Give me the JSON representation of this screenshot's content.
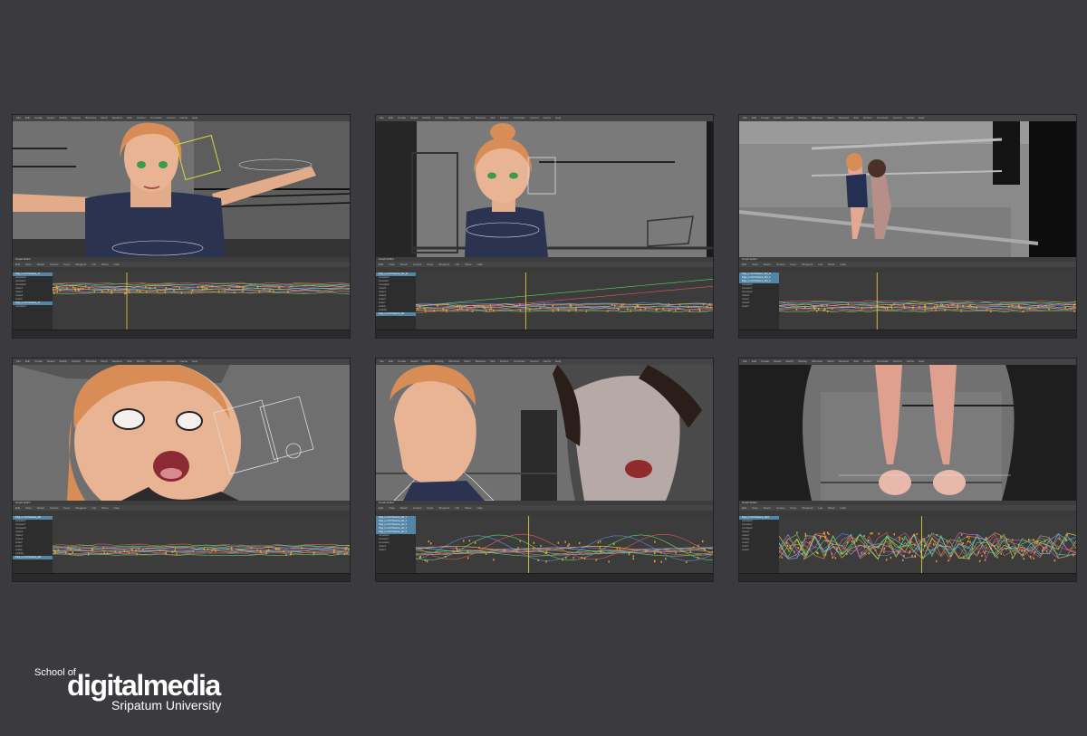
{
  "menu": [
    "File",
    "Edit",
    "Create",
    "Select",
    "Modify",
    "Display",
    "Windows",
    "Mesh",
    "Skeleton",
    "Skin",
    "Deform",
    "Constrain",
    "Control",
    "Cache",
    "Help"
  ],
  "graph_editor": {
    "title": "Graph Editor",
    "menus": [
      "Edit",
      "View",
      "Select",
      "Curves",
      "Keys",
      "Tangents",
      "List",
      "Show",
      "Help"
    ]
  },
  "colors": {
    "background": "#3b3a3e",
    "selected_row": "#5285a6",
    "keys": "#e8a02a",
    "time_marker": "#f4d62f"
  },
  "panels": [
    {
      "id": "p1",
      "channels": [
        "Ptgs_Lc:ctrl.Sharma_I3",
        "translateX",
        "translateY",
        "translateZ",
        "rotateX",
        "rotateY",
        "rotateZ",
        "scaleX",
        "Ptgs_Lc:ctrl.Sharma_I4",
        "translateX"
      ],
      "selected": [
        0,
        8
      ]
    },
    {
      "id": "p2",
      "channels": [
        "Ptgs_Lc:ctrl.Sharma_Ncl_R",
        "translateX",
        "translateY",
        "translateZ",
        "rotateX",
        "rotateY",
        "rotateZ",
        "scaleX",
        "scaleY",
        "scaleZ",
        "visibility",
        "Ptgs_Lc:ctrl.Sharma_M2"
      ],
      "selected": [
        0,
        11
      ]
    },
    {
      "id": "p3",
      "channels": [
        "Ptgs_Lc:ctrl.Sharma_Ncl_R",
        "Ptgs_Lc:ctrl.Sharma_Ncl_L",
        "Ptgs_Lc:ctrl.Sharma_Ncl_2",
        "translateX",
        "translateY",
        "translateZ",
        "rotateX",
        "rotateY",
        "rotateZ",
        "scaleX"
      ],
      "selected": [
        0,
        1,
        2
      ]
    },
    {
      "id": "p4",
      "channels": [
        "Ptgs_Lc:ctrl.Sharma_M1",
        "translateX",
        "translateY",
        "translateZ",
        "rotateX",
        "rotateY",
        "rotateZ",
        "scaleX",
        "scaleY",
        "scaleZ",
        "visibility",
        "Ptgs_Lc:ctrl.Sharma_M2"
      ],
      "selected": [
        0,
        11
      ]
    },
    {
      "id": "p5",
      "channels": [
        "Ptgs_Lc:ctrl.Sharma_Hd_1",
        "Ptgs_Lc:ctrl.Sharma_Hd_2",
        "Ptgs_Lc:ctrl.Sharma_Hd_3",
        "Ptgs_Lc:ctrl.Sharma_Hd_4",
        "Ptgs_Lc:ctrl.Sharma_Hd_5",
        "translateX",
        "translateY",
        "translateZ",
        "rotateX",
        "rotateY"
      ],
      "selected": [
        0,
        1,
        2,
        3,
        4
      ]
    },
    {
      "id": "p6",
      "channels": [
        "Ptgs_Lc:ctrl.Sharma_Hips",
        "translateX",
        "translateY",
        "translateZ",
        "rotateX",
        "rotateY",
        "rotateZ",
        "scaleX",
        "scaleY",
        "scaleZ"
      ],
      "selected": [
        0
      ]
    }
  ],
  "logo": {
    "top": "School of",
    "main": "digitalmedia",
    "bottom": "Sripatum University"
  }
}
